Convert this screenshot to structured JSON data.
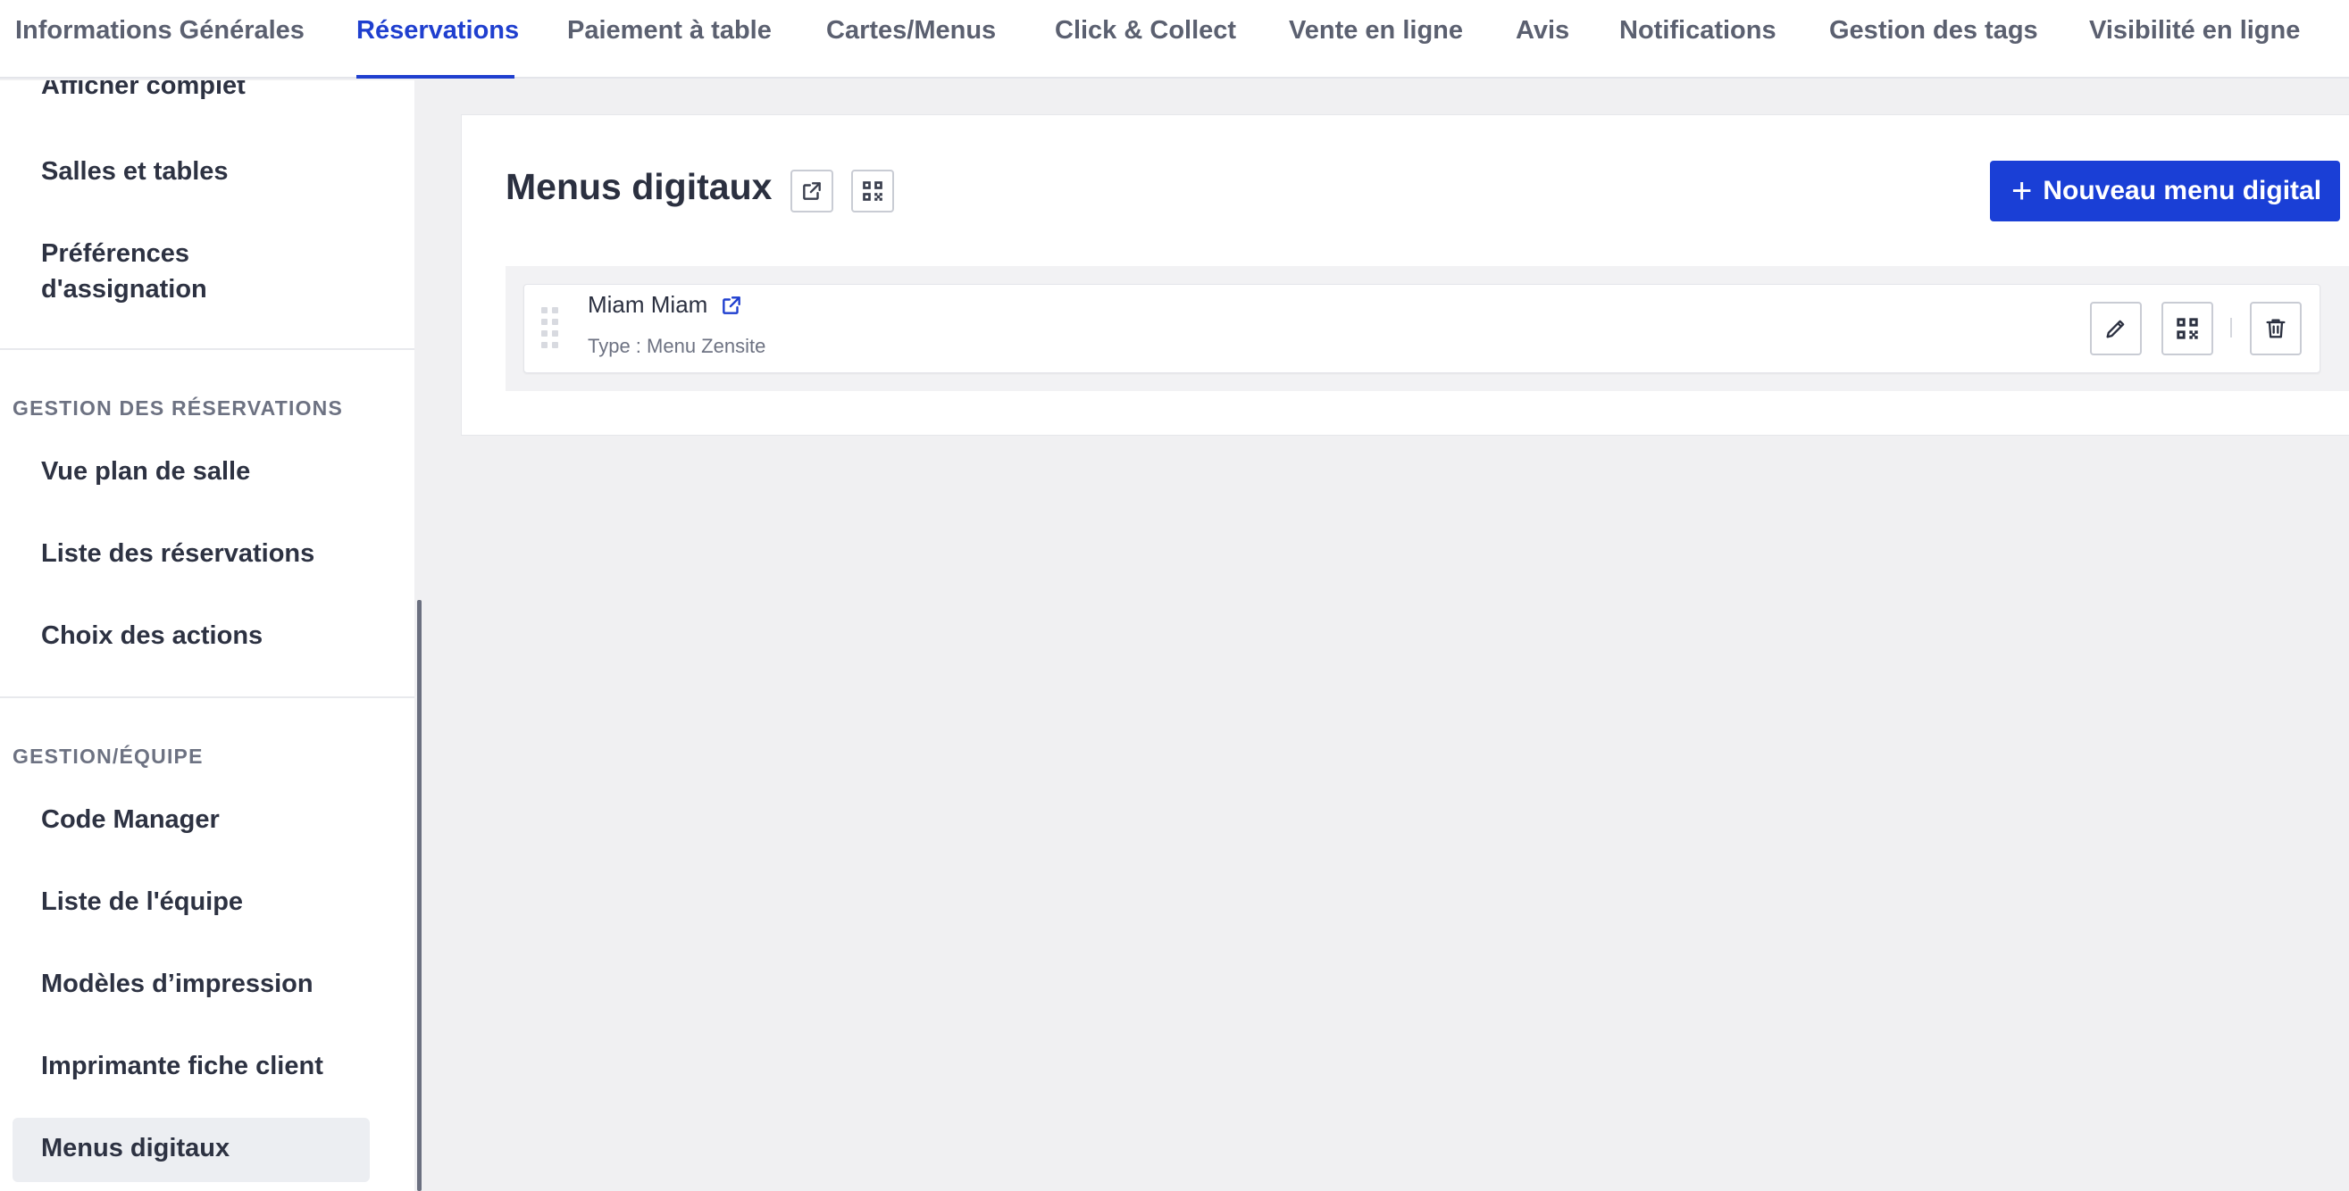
{
  "tabs": [
    {
      "label": "Informations Générales",
      "active": false
    },
    {
      "label": "Réservations",
      "active": true
    },
    {
      "label": "Paiement à table",
      "active": false
    },
    {
      "label": "Cartes/Menus",
      "active": false
    },
    {
      "label": "Click & Collect",
      "active": false
    },
    {
      "label": "Vente en ligne",
      "active": false
    },
    {
      "label": "Avis",
      "active": false
    },
    {
      "label": "Notifications",
      "active": false
    },
    {
      "label": "Gestion des tags",
      "active": false
    },
    {
      "label": "Visibilité en ligne",
      "active": false
    }
  ],
  "sidebar": {
    "top_items": [
      {
        "label": "Afficher complet"
      },
      {
        "label": "Salles et tables"
      },
      {
        "label": "Préférences"
      },
      {
        "label": "d'assignation"
      }
    ],
    "sections": [
      {
        "title": "GESTION DES RÉSERVATIONS",
        "items": [
          {
            "label": "Vue plan de salle"
          },
          {
            "label": "Liste des réservations"
          },
          {
            "label": "Choix des actions"
          }
        ]
      },
      {
        "title": "GESTION/ÉQUIPE",
        "items": [
          {
            "label": "Code Manager"
          },
          {
            "label": "Liste de l'équipe"
          },
          {
            "label": "Modèles d’impression"
          },
          {
            "label": "Imprimante fiche client"
          },
          {
            "label": "Menus digitaux",
            "selected": true
          }
        ]
      }
    ]
  },
  "main": {
    "title": "Menus digitaux",
    "new_button_label": "Nouveau menu digital",
    "menus": [
      {
        "name": "Miam Miam",
        "type": "Type : Menu Zensite"
      }
    ]
  },
  "colors": {
    "accent": "#1f3fcf",
    "button": "#1a3fd6",
    "background": "#f0f0f2"
  },
  "icons": {
    "external_link": "external-link-icon",
    "qr_code": "qr-code-icon",
    "edit": "pencil-icon",
    "delete": "trash-icon",
    "drag": "drag-handle-icon",
    "add": "plus-icon"
  }
}
